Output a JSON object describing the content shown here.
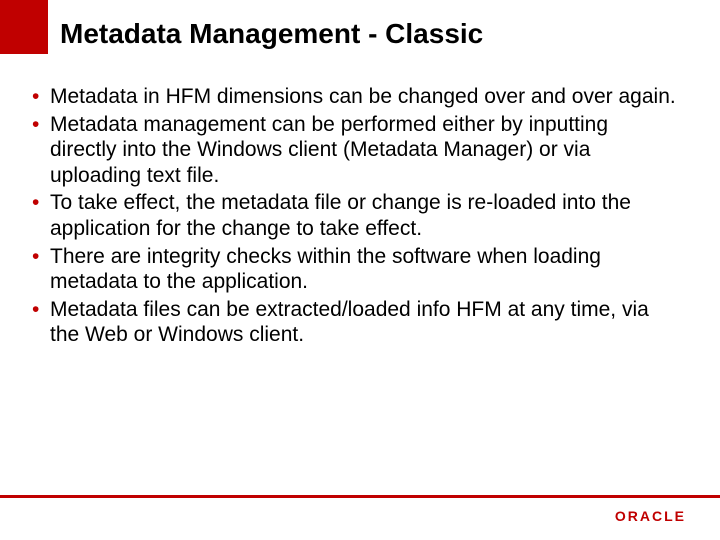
{
  "title": "Metadata Management - Classic",
  "bullets": [
    "Metadata in HFM dimensions can be changed over and over again.",
    "Metadata management can be performed either by inputting directly into the Windows client (Metadata Manager) or via uploading text file.",
    "To take effect, the metadata file or change is re-loaded into the application for the change to take effect.",
    "There are integrity checks within the software when loading metadata to the application.",
    "Metadata files can be extracted/loaded info HFM at any time, via the Web or Windows client."
  ],
  "footer": {
    "brand": "ORACLE"
  }
}
